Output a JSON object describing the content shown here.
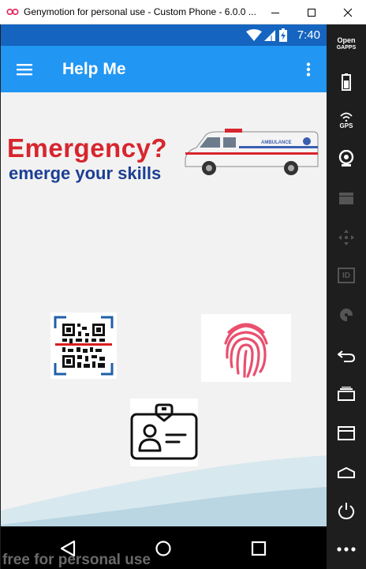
{
  "window": {
    "title": "Genymotion for personal use - Custom Phone - 6.0.0 ...",
    "watermark": "free for personal use"
  },
  "statusbar": {
    "time": "7:40"
  },
  "appbar": {
    "title": "Help Me"
  },
  "banner": {
    "headline": "Emergency?",
    "tagline": "emerge your skills",
    "vehicle_label": "AMBULANCE"
  },
  "sidebar": {
    "opengapps_line1": "Open",
    "opengapps_line2": "GAPPS",
    "gps_label": "GPS",
    "id_label": "ID"
  },
  "colors": {
    "statusbar": "#1565c0",
    "appbar": "#2196f3",
    "fab": "#3dbd6f",
    "headline_red": "#d7262e",
    "tagline_blue": "#1c3f94",
    "fingerprint": "#e8506e",
    "qr_frame": "#1f5fa8",
    "scan_line": "#d81e1e"
  }
}
